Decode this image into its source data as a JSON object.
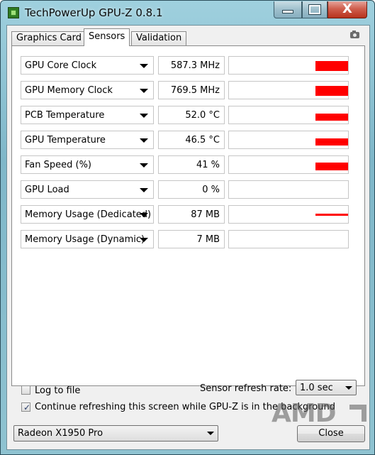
{
  "window": {
    "title": "TechPowerUp GPU-Z 0.8.1",
    "close_glyph": "X"
  },
  "tabs": [
    {
      "label": "Graphics Card",
      "active": false
    },
    {
      "label": "Sensors",
      "active": true
    },
    {
      "label": "Validation",
      "active": false
    }
  ],
  "sensors": [
    {
      "name": "GPU Core Clock",
      "value": "587.3 MHz",
      "graph_fill": 0.55
    },
    {
      "name": "GPU Memory Clock",
      "value": "769.5 MHz",
      "graph_fill": 0.55
    },
    {
      "name": "PCB Temperature",
      "value": "52.0 °C",
      "graph_fill": 0.4
    },
    {
      "name": "GPU Temperature",
      "value": "46.5 °C",
      "graph_fill": 0.4
    },
    {
      "name": "Fan Speed (%)",
      "value": "41 %",
      "graph_fill": 0.41
    },
    {
      "name": "GPU Load",
      "value": "0 %",
      "graph_fill": 0
    },
    {
      "name": "Memory Usage (Dedicated)",
      "value": "87 MB",
      "graph_fill": 0.15
    },
    {
      "name": "Memory Usage (Dynamic)",
      "value": "7 MB",
      "graph_fill": 0
    }
  ],
  "options": {
    "log_to_file_label": "Log to file",
    "log_to_file_checked": false,
    "refresh_label": "Sensor refresh rate:",
    "refresh_value": "1.0 sec",
    "continue_label": "Continue refreshing this screen while GPU-Z is in the background",
    "continue_checked": true
  },
  "footer": {
    "gpu_select": "Radeon X1950 Pro",
    "close_label": "Close",
    "logo_text": "AMD"
  },
  "colors": {
    "graph": "#ff0000",
    "check": "#2b3e6a"
  },
  "icons": [
    "app-icon",
    "camera-icon",
    "dropdown-arrow-icon",
    "check-icon"
  ]
}
